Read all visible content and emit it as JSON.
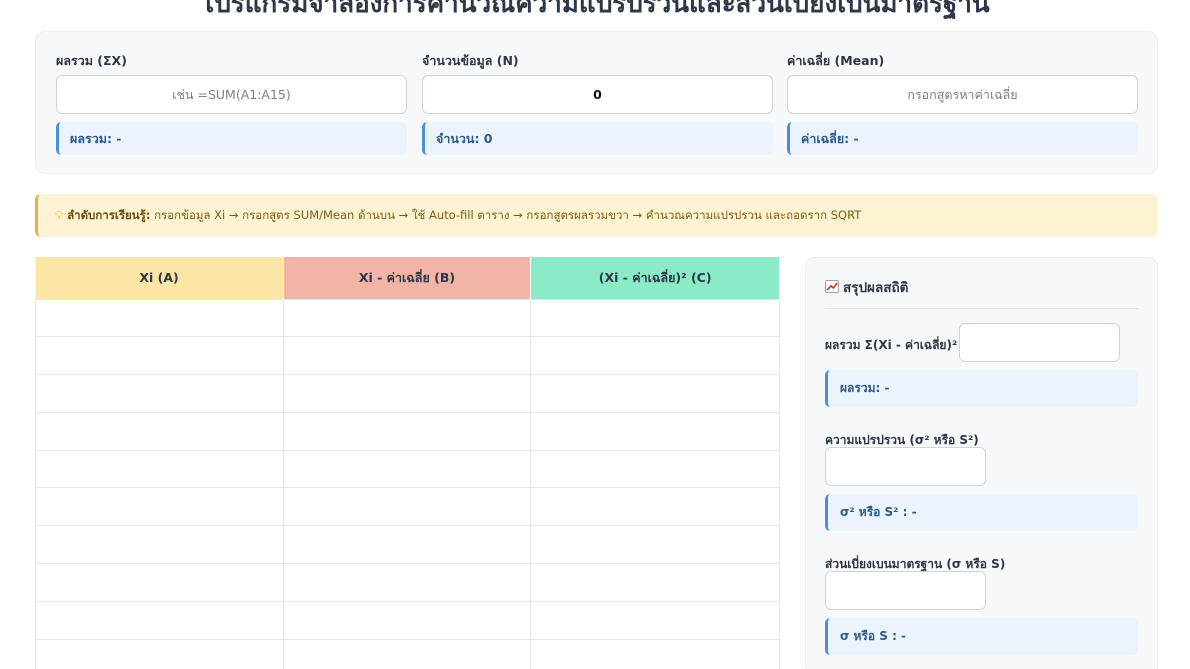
{
  "page": {
    "title": "โปรแกรมจำลองการคำนวณความแปรปรวนและส่วนเบี่ยงเบนมาตรฐาน"
  },
  "top_fields": {
    "sum": {
      "label": "ผลรวม (ΣX)",
      "placeholder": "เช่น =SUM(A1:A15)",
      "value": "",
      "result": "ผลรวม: -"
    },
    "count": {
      "label": "จำนวนข้อมูล (N)",
      "placeholder": "",
      "value": "0",
      "result": "จำนวน: 0"
    },
    "mean": {
      "label": "ค่าเฉลี่ย (Mean)",
      "placeholder": "กรอกสูตรหาค่าเฉลี่ย",
      "value": "",
      "result": "ค่าเฉลี่ย: -"
    }
  },
  "hint": {
    "icon": "lightbulb-icon",
    "bold": "ลำดับการเรียนรู้:",
    "text": " กรอกข้อมูล Xi → กรอกสูตร SUM/Mean ด้านบน → ใช้ Auto-fill ตาราง → กรอกสูตรผลรวมขวา → คำนวณความแปรปรวน และถอดราก SQRT"
  },
  "table": {
    "headers": [
      "Xi (A)",
      "Xi - ค่าเฉลี่ย (B)",
      "(Xi - ค่าเฉลี่ย)² (C)"
    ],
    "header_colors": [
      "#fbe6a6",
      "#f1b4a6",
      "#8bebc6"
    ],
    "rows": [
      [
        "",
        "",
        ""
      ],
      [
        "",
        "",
        ""
      ],
      [
        "",
        "",
        ""
      ],
      [
        "",
        "",
        ""
      ],
      [
        "",
        "",
        ""
      ],
      [
        "",
        "",
        ""
      ],
      [
        "",
        "",
        ""
      ],
      [
        "",
        "",
        ""
      ],
      [
        "",
        "",
        ""
      ],
      [
        "",
        "",
        ""
      ]
    ]
  },
  "stats": {
    "icon": "chart-increasing-icon",
    "title": "สรุปผลสถิติ",
    "sum_sq_label": "ผลรวม Σ(Xi - ค่าเฉลี่ย)²",
    "sum_sq_value": "",
    "sum_sq_result": "ผลรวม: -",
    "variance_label": "ความแปรปรวน (σ² หรือ S²)",
    "variance_value": "",
    "variance_result": "σ² หรือ S² : -",
    "stddev_label": "ส่วนเบี่ยงเบนมาตรฐาน (σ หรือ S)",
    "stddev_value": "",
    "stddev_result": "σ หรือ S : -"
  },
  "colors": {
    "accent": "#4a90d9",
    "result_bg": "#ebf4fd",
    "hint_bg": "#fdf3d3"
  }
}
